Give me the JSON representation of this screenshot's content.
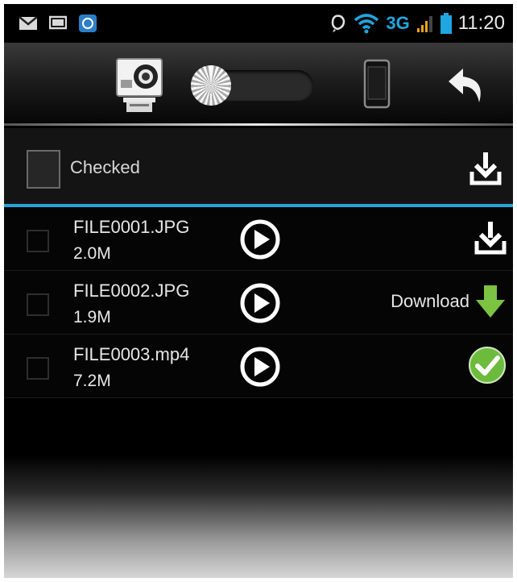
{
  "status_bar": {
    "network": "3G",
    "time": "11:20"
  },
  "header": {
    "checked_label": "Checked"
  },
  "files": [
    {
      "name": "FILE0001.JPG",
      "size": "2.0M",
      "action": "download-icon"
    },
    {
      "name": "FILE0002.JPG",
      "size": "1.9M",
      "action": "Download"
    },
    {
      "name": "FILE0003.mp4",
      "size": "7.2M",
      "action": "done"
    }
  ],
  "colors": {
    "accent": "#26a3d8",
    "download_green": "#7cc243",
    "done_green": "#6dbb3c"
  }
}
